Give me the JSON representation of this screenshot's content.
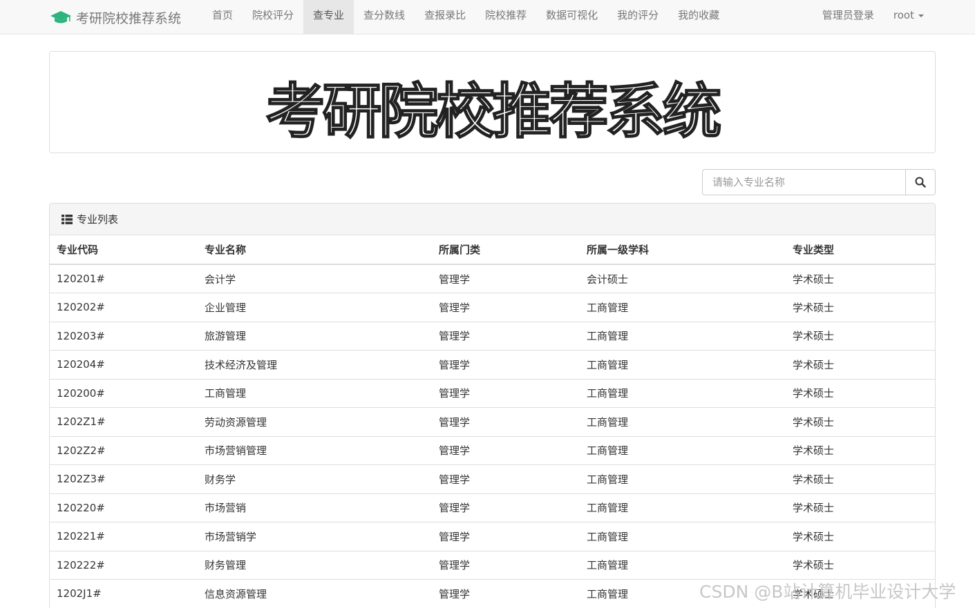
{
  "navbar": {
    "brand": "考研院校推荐系统",
    "links": [
      "首页",
      "院校评分",
      "查专业",
      "查分数线",
      "查报录比",
      "院校推荐",
      "数据可视化",
      "我的评分",
      "我的收藏"
    ],
    "active_index": 2,
    "admin_login": "管理员登录",
    "user": "root"
  },
  "banner": {
    "title": "考研院校推荐系统"
  },
  "search": {
    "placeholder": "请输入专业名称",
    "icon": "search-icon"
  },
  "panel": {
    "title": "专业列表",
    "icon": "list-icon",
    "columns": [
      "专业代码",
      "专业名称",
      "所属门类",
      "所属一级学科",
      "专业类型"
    ],
    "rows": [
      [
        "120201#",
        "会计学",
        "管理学",
        "会计硕士",
        "学术硕士"
      ],
      [
        "120202#",
        "企业管理",
        "管理学",
        "工商管理",
        "学术硕士"
      ],
      [
        "120203#",
        "旅游管理",
        "管理学",
        "工商管理",
        "学术硕士"
      ],
      [
        "120204#",
        "技术经济及管理",
        "管理学",
        "工商管理",
        "学术硕士"
      ],
      [
        "120200#",
        "工商管理",
        "管理学",
        "工商管理",
        "学术硕士"
      ],
      [
        "1202Z1#",
        "劳动资源管理",
        "管理学",
        "工商管理",
        "学术硕士"
      ],
      [
        "1202Z2#",
        "市场营销管理",
        "管理学",
        "工商管理",
        "学术硕士"
      ],
      [
        "1202Z3#",
        "财务学",
        "管理学",
        "工商管理",
        "学术硕士"
      ],
      [
        "120220#",
        "市场营销",
        "管理学",
        "工商管理",
        "学术硕士"
      ],
      [
        "120221#",
        "市场营销学",
        "管理学",
        "工商管理",
        "学术硕士"
      ],
      [
        "120222#",
        "财务管理",
        "管理学",
        "工商管理",
        "学术硕士"
      ],
      [
        "1202J1#",
        "信息资源管理",
        "管理学",
        "工商管理",
        "学术硕士"
      ]
    ]
  },
  "watermark": "CSDN @B站计算机毕业设计大学",
  "colors": {
    "brand_icon": "#2db37d",
    "navbar_bg": "#f8f8f8",
    "active_tab_bg": "#e7e7e7"
  }
}
